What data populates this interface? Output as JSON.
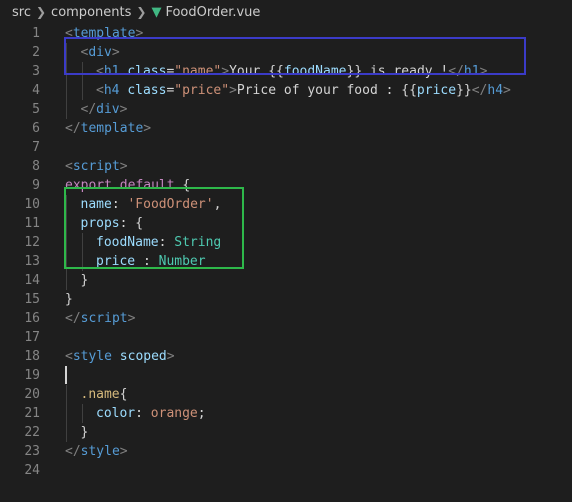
{
  "breadcrumb": {
    "segments": [
      "src",
      "components"
    ],
    "file_icon": "vue-logo-icon",
    "file_name": "FoodOrder.vue"
  },
  "colors": {
    "highlight_box_template": "#3b3bc8",
    "highlight_box_props": "#2eb84a",
    "vue_logo": "#41b883"
  },
  "lines": [
    {
      "num": "1",
      "indent": 0,
      "tokens": [
        [
          "t-punct",
          "<"
        ],
        [
          "t-tag",
          "template"
        ],
        [
          "t-punct",
          ">"
        ]
      ]
    },
    {
      "num": "2",
      "indent": 1,
      "tokens": [
        [
          "t-punct",
          "<"
        ],
        [
          "t-tag",
          "div"
        ],
        [
          "t-punct",
          ">"
        ]
      ]
    },
    {
      "num": "3",
      "indent": 2,
      "tokens": [
        [
          "t-punct",
          "<"
        ],
        [
          "t-tag",
          "h1"
        ],
        [
          "t-text",
          " "
        ],
        [
          "t-attr",
          "class"
        ],
        [
          "t-text",
          "="
        ],
        [
          "t-str",
          "\"name\""
        ],
        [
          "t-punct",
          ">"
        ],
        [
          "t-text",
          "Your {{"
        ],
        [
          "t-attr",
          "foodName"
        ],
        [
          "t-text",
          "}} is ready !"
        ],
        [
          "t-punct",
          "</"
        ],
        [
          "t-tag",
          "h1"
        ],
        [
          "t-punct",
          ">"
        ]
      ]
    },
    {
      "num": "4",
      "indent": 2,
      "tokens": [
        [
          "t-punct",
          "<"
        ],
        [
          "t-tag",
          "h4"
        ],
        [
          "t-text",
          " "
        ],
        [
          "t-attr",
          "class"
        ],
        [
          "t-text",
          "="
        ],
        [
          "t-str",
          "\"price\""
        ],
        [
          "t-punct",
          ">"
        ],
        [
          "t-text",
          "Price of your food : {{"
        ],
        [
          "t-attr",
          "price"
        ],
        [
          "t-text",
          "}}"
        ],
        [
          "t-punct",
          "</"
        ],
        [
          "t-tag",
          "h4"
        ],
        [
          "t-punct",
          ">"
        ]
      ]
    },
    {
      "num": "5",
      "indent": 1,
      "tokens": [
        [
          "t-punct",
          "</"
        ],
        [
          "t-tag",
          "div"
        ],
        [
          "t-punct",
          ">"
        ]
      ]
    },
    {
      "num": "6",
      "indent": 0,
      "tokens": [
        [
          "t-punct",
          "</"
        ],
        [
          "t-tag",
          "template"
        ],
        [
          "t-punct",
          ">"
        ]
      ]
    },
    {
      "num": "7",
      "indent": 0,
      "tokens": []
    },
    {
      "num": "8",
      "indent": 0,
      "tokens": [
        [
          "t-punct",
          "<"
        ],
        [
          "t-tag",
          "script"
        ],
        [
          "t-punct",
          ">"
        ]
      ]
    },
    {
      "num": "9",
      "indent": 0,
      "tokens": [
        [
          "t-kw",
          "export"
        ],
        [
          "t-text",
          " "
        ],
        [
          "t-kw",
          "default"
        ],
        [
          "t-text",
          " {"
        ]
      ]
    },
    {
      "num": "10",
      "indent": 1,
      "tokens": [
        [
          "t-prop",
          "name"
        ],
        [
          "t-text",
          ": "
        ],
        [
          "t-str",
          "'FoodOrder'"
        ],
        [
          "t-text",
          ","
        ]
      ]
    },
    {
      "num": "11",
      "indent": 1,
      "tokens": [
        [
          "t-prop",
          "props"
        ],
        [
          "t-text",
          ": {"
        ]
      ]
    },
    {
      "num": "12",
      "indent": 2,
      "tokens": [
        [
          "t-prop",
          "foodName"
        ],
        [
          "t-text",
          ": "
        ],
        [
          "t-type",
          "String"
        ]
      ]
    },
    {
      "num": "13",
      "indent": 2,
      "tokens": [
        [
          "t-prop",
          "price"
        ],
        [
          "t-text",
          " : "
        ],
        [
          "t-type",
          "Number"
        ]
      ]
    },
    {
      "num": "14",
      "indent": 1,
      "tokens": [
        [
          "t-text",
          "}"
        ]
      ]
    },
    {
      "num": "15",
      "indent": 0,
      "tokens": [
        [
          "t-text",
          "}"
        ]
      ]
    },
    {
      "num": "16",
      "indent": 0,
      "tokens": [
        [
          "t-punct",
          "</"
        ],
        [
          "t-tag",
          "script"
        ],
        [
          "t-punct",
          ">"
        ]
      ]
    },
    {
      "num": "17",
      "indent": 0,
      "tokens": []
    },
    {
      "num": "18",
      "indent": 0,
      "tokens": [
        [
          "t-punct",
          "<"
        ],
        [
          "t-tag",
          "style"
        ],
        [
          "t-text",
          " "
        ],
        [
          "t-attr",
          "scoped"
        ],
        [
          "t-punct",
          ">"
        ]
      ]
    },
    {
      "num": "19",
      "indent": 0,
      "tokens": [],
      "cursor": true
    },
    {
      "num": "20",
      "indent": 1,
      "tokens": [
        [
          "t-sel",
          ".name"
        ],
        [
          "t-text",
          "{"
        ]
      ]
    },
    {
      "num": "21",
      "indent": 2,
      "tokens": [
        [
          "t-prop",
          "color"
        ],
        [
          "t-text",
          ": "
        ],
        [
          "t-ocolor",
          "orange"
        ],
        [
          "t-text",
          ";"
        ]
      ]
    },
    {
      "num": "22",
      "indent": 1,
      "tokens": [
        [
          "t-text",
          "}"
        ]
      ]
    },
    {
      "num": "23",
      "indent": 0,
      "tokens": [
        [
          "t-punct",
          "</"
        ],
        [
          "t-tag",
          "style"
        ],
        [
          "t-punct",
          ">"
        ]
      ]
    },
    {
      "num": "24",
      "indent": 0,
      "tokens": []
    }
  ]
}
